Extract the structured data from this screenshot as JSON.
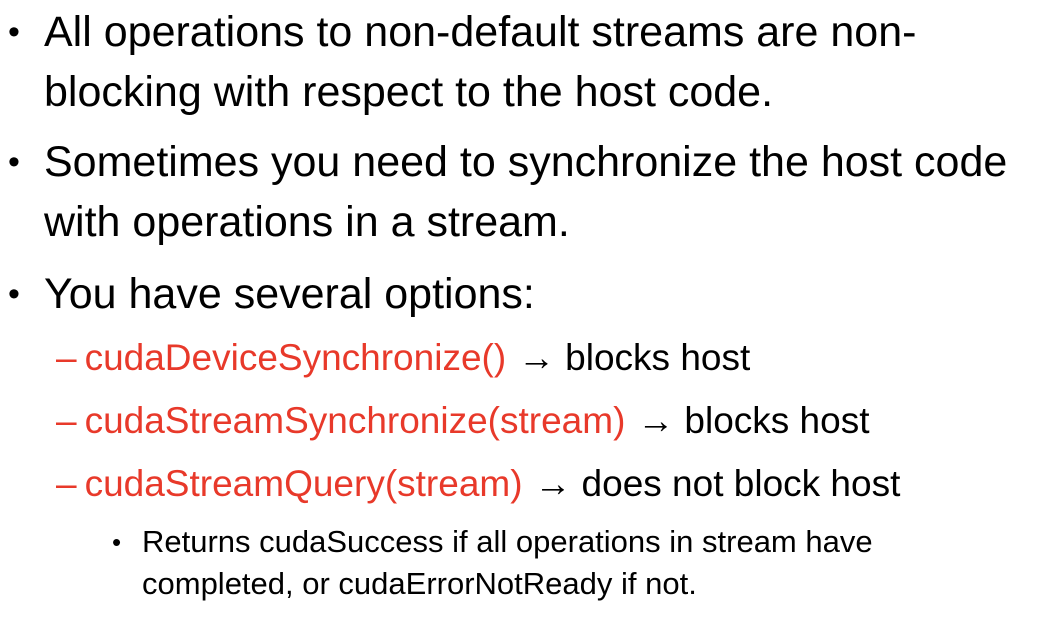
{
  "bullets": [
    {
      "text": "All operations to non-default streams are non-blocking with respect to the host code."
    },
    {
      "text": "Sometimes you need to synchronize the host code with operations in a stream."
    },
    {
      "text": "You have several options:"
    }
  ],
  "options": [
    {
      "dash": "–",
      "fn": "cudaDeviceSynchronize()",
      "arrow": "→",
      "effect": "blocks host"
    },
    {
      "dash": "–",
      "fn": "cudaStreamSynchronize(stream)",
      "arrow": "→",
      "effect": "blocks host"
    },
    {
      "dash": "–",
      "fn": "cudaStreamQuery(stream)",
      "arrow": "→",
      "effect": "does not block host"
    }
  ],
  "sub_note": {
    "text": "Returns cudaSuccess if all operations in stream have completed, or cudaErrorNotReady if not."
  },
  "colors": {
    "accent": "#e8392a",
    "text": "#000000",
    "background": "#ffffff"
  }
}
